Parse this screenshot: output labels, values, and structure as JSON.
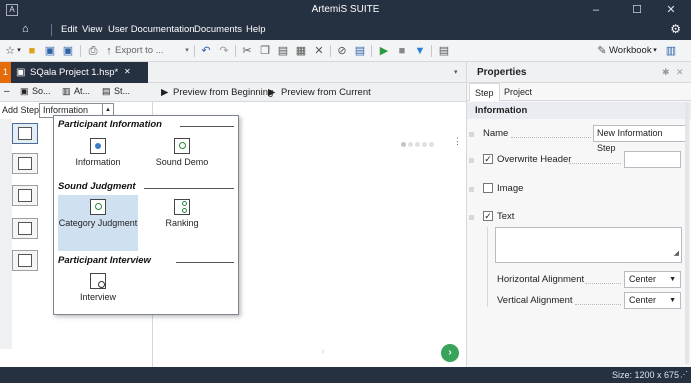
{
  "window": {
    "app_icon": "A",
    "title": "ArtemiS SUITE",
    "controls": {
      "minimize": "–",
      "maximize": "☐",
      "close": "✕"
    }
  },
  "menubar": {
    "home_icon": "home-icon",
    "items": [
      "Edit",
      "View",
      "User Documentation",
      "Documents",
      "Help"
    ]
  },
  "toolbar": {
    "export_label": "Export to ...",
    "workbook_label": "Workbook"
  },
  "document_tab": {
    "number": "1",
    "label": "SQala Project 1.hsp*",
    "close": "✕"
  },
  "left_panel": {
    "tabs": [
      "So...",
      "At...",
      "St..."
    ],
    "add_step_label": "Add Step:",
    "add_step_value": "Information"
  },
  "center": {
    "preview_beginning": "Preview from Beginning",
    "preview_current": "Preview from Current"
  },
  "step_menu": {
    "groups": [
      {
        "title": "Participant Information",
        "items": [
          {
            "label": "Information"
          },
          {
            "label": "Sound Demo"
          }
        ]
      },
      {
        "title": "Sound Judgment",
        "items": [
          {
            "label": "Category Judgment"
          },
          {
            "label": "Ranking"
          }
        ]
      },
      {
        "title": "Participant Interview",
        "items": [
          {
            "label": "Interview"
          }
        ]
      }
    ]
  },
  "properties": {
    "title": "Properties",
    "tabs": [
      "Step",
      "Project"
    ],
    "section": "Information",
    "name_label": "Name",
    "name_value": "New Information Step",
    "overwrite_header_label": "Overwrite Header",
    "overwrite_header_checked": true,
    "image_label": "Image",
    "image_checked": false,
    "text_label": "Text",
    "text_checked": true,
    "horizontal_alignment_label": "Horizontal Alignment",
    "horizontal_alignment_value": "Center",
    "vertical_alignment_label": "Vertical Alignment",
    "vertical_alignment_value": "Center"
  },
  "status": {
    "size_text": "Size: 1200 x 675"
  },
  "colors": {
    "titlebar": "#253041",
    "tab_accent": "#e46c0a",
    "next_button": "#3aa35a",
    "selection": "#cfe0f0"
  }
}
